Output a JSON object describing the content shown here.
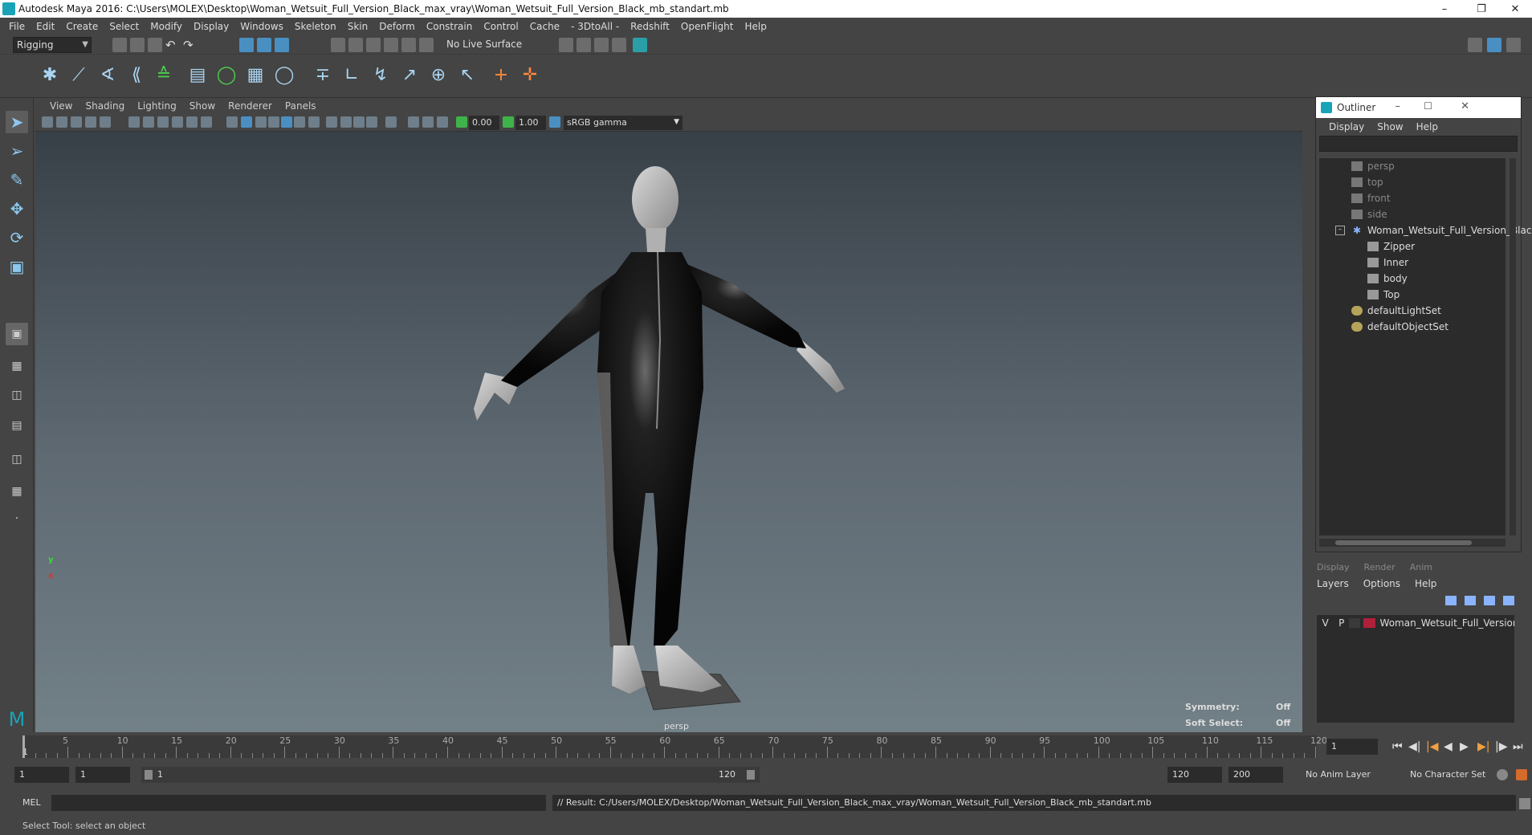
{
  "window": {
    "title": "Autodesk Maya 2016: C:\\Users\\MOLEX\\Desktop\\Woman_Wetsuit_Full_Version_Black_max_vray\\Woman_Wetsuit_Full_Version_Black_mb_standart.mb"
  },
  "menu": [
    "File",
    "Edit",
    "Create",
    "Select",
    "Modify",
    "Display",
    "Windows",
    "Skeleton",
    "Skin",
    "Deform",
    "Constrain",
    "Control",
    "Cache",
    "- 3DtoAll -",
    "Redshift",
    "OpenFlight",
    "Help"
  ],
  "shelf": {
    "mode": "Rigging",
    "live_surface": "No Live Surface"
  },
  "viewport": {
    "menu": [
      "View",
      "Shading",
      "Lighting",
      "Show",
      "Renderer",
      "Panels"
    ],
    "exposure": "0.00",
    "gamma": "1.00",
    "color_space": "sRGB gamma",
    "camera_label": "persp",
    "symmetry_label": "Symmetry:",
    "symmetry_value": "Off",
    "soft_select_label": "Soft Select:",
    "soft_select_value": "Off",
    "axis_x": "x",
    "axis_y": "y"
  },
  "outliner": {
    "title": "Outliner",
    "menu": [
      "Display",
      "Show",
      "Help"
    ],
    "items": [
      {
        "label": "persp",
        "dim": true,
        "indent": 0
      },
      {
        "label": "top",
        "dim": true,
        "indent": 0
      },
      {
        "label": "front",
        "dim": true,
        "indent": 0
      },
      {
        "label": "side",
        "dim": true,
        "indent": 0
      },
      {
        "label": "Woman_Wetsuit_Full_Version_Blac",
        "dim": false,
        "indent": 0
      },
      {
        "label": "Zipper",
        "dim": false,
        "indent": 1
      },
      {
        "label": "Inner",
        "dim": false,
        "indent": 1
      },
      {
        "label": "body",
        "dim": false,
        "indent": 1
      },
      {
        "label": "Top",
        "dim": false,
        "indent": 1
      },
      {
        "label": "defaultLightSet",
        "dim": false,
        "indent": 0
      },
      {
        "label": "defaultObjectSet",
        "dim": false,
        "indent": 0
      }
    ]
  },
  "layers": {
    "tabs": [
      "Display",
      "Render",
      "Anim"
    ],
    "menu": [
      "Layers",
      "Options",
      "Help"
    ],
    "row": {
      "v": "V",
      "p": "P",
      "name": "Woman_Wetsuit_Full_Version_Bl",
      "color": "#b0203a"
    }
  },
  "timeline": {
    "labels": [
      "5",
      "10",
      "15",
      "20",
      "25",
      "30",
      "35",
      "40",
      "45",
      "50",
      "55",
      "60",
      "65",
      "70",
      "75",
      "80",
      "85",
      "90",
      "95",
      "100",
      "105",
      "110",
      "115",
      "120"
    ],
    "start_label": "1",
    "current_frame": "1"
  },
  "range": {
    "start": "1",
    "playback_start": "1",
    "slider_start": "1",
    "slider_end": "120",
    "playback_end": "120",
    "end": "200",
    "anim_layer": "No Anim Layer",
    "character_set": "No Character Set"
  },
  "command": {
    "lang": "MEL",
    "result": "// Result: C:/Users/MOLEX/Desktop/Woman_Wetsuit_Full_Version_Black_max_vray/Woman_Wetsuit_Full_Version_Black_mb_standart.mb"
  },
  "help_line": "Select Tool: select an object"
}
